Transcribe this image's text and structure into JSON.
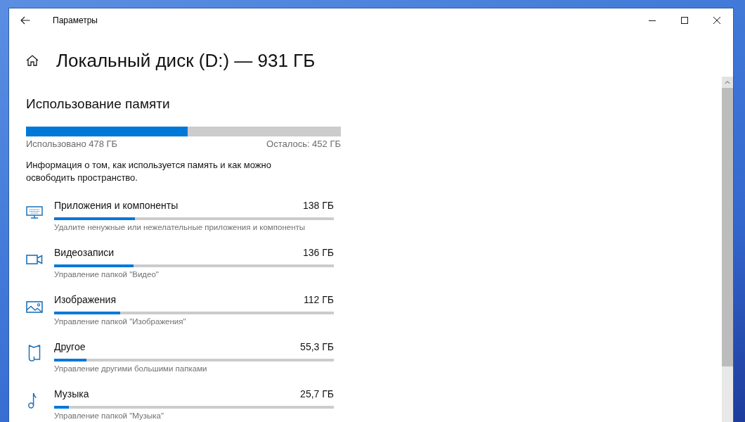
{
  "window": {
    "title": "Параметры"
  },
  "page": {
    "title": "Локальный диск (D:) — 931 ГБ"
  },
  "usage": {
    "heading": "Использование памяти",
    "level": 0.513,
    "used": "Использовано 478 ГБ",
    "remaining": "Осталось: 452 ГБ",
    "description": "Информация о том, как используется память и как можно освободить пространство."
  },
  "categories": [
    {
      "kind": "apps",
      "name": "Приложения и компоненты",
      "size": "138 ГБ",
      "level": 0.289,
      "description": "Удалите ненужные или нежелательные приложения и компоненты"
    },
    {
      "kind": "video",
      "name": "Видеозаписи",
      "size": "136 ГБ",
      "level": 0.285,
      "description": "Управление папкой \"Видео\""
    },
    {
      "kind": "pictures",
      "name": "Изображения",
      "size": "112 ГБ",
      "level": 0.235,
      "description": "Управление папкой \"Изображения\""
    },
    {
      "kind": "other",
      "name": "Другое",
      "size": "55,3 ГБ",
      "level": 0.116,
      "description": "Управление другими большими папками"
    },
    {
      "kind": "music",
      "name": "Музыка",
      "size": "25,7 ГБ",
      "level": 0.054,
      "description": "Управление папкой \"Музыка\""
    }
  ]
}
